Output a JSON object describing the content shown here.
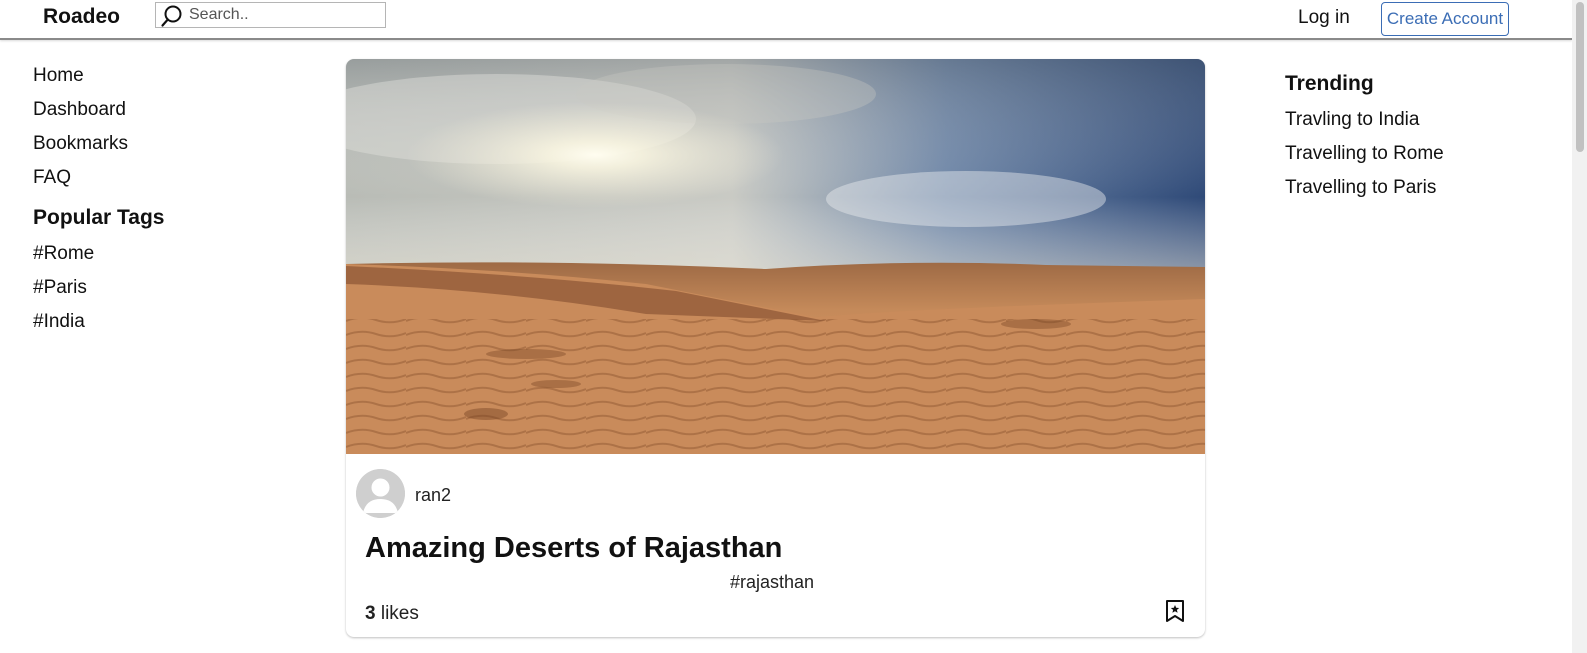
{
  "header": {
    "brand": "Roadeo",
    "search_placeholder": "Search..",
    "login_label": "Log in",
    "create_account_label": "Create Account"
  },
  "sidebar": {
    "nav": [
      "Home",
      "Dashboard",
      "Bookmarks",
      "FAQ"
    ],
    "popular_tags_title": "Popular Tags",
    "tags": [
      "#Rome",
      "#Paris",
      "#India"
    ]
  },
  "trending": {
    "title": "Trending",
    "items": [
      "Travling to India",
      "Travelling to Rome",
      "Travelling to Paris"
    ]
  },
  "post": {
    "author": "ran2",
    "title": "Amazing Deserts of Rajasthan",
    "tag": "#rajasthan",
    "likes_count": "3",
    "likes_label": " likes"
  },
  "colors": {
    "accent": "#3b6db5",
    "sand": "#c98a56",
    "sky": "#3a5a8a"
  }
}
